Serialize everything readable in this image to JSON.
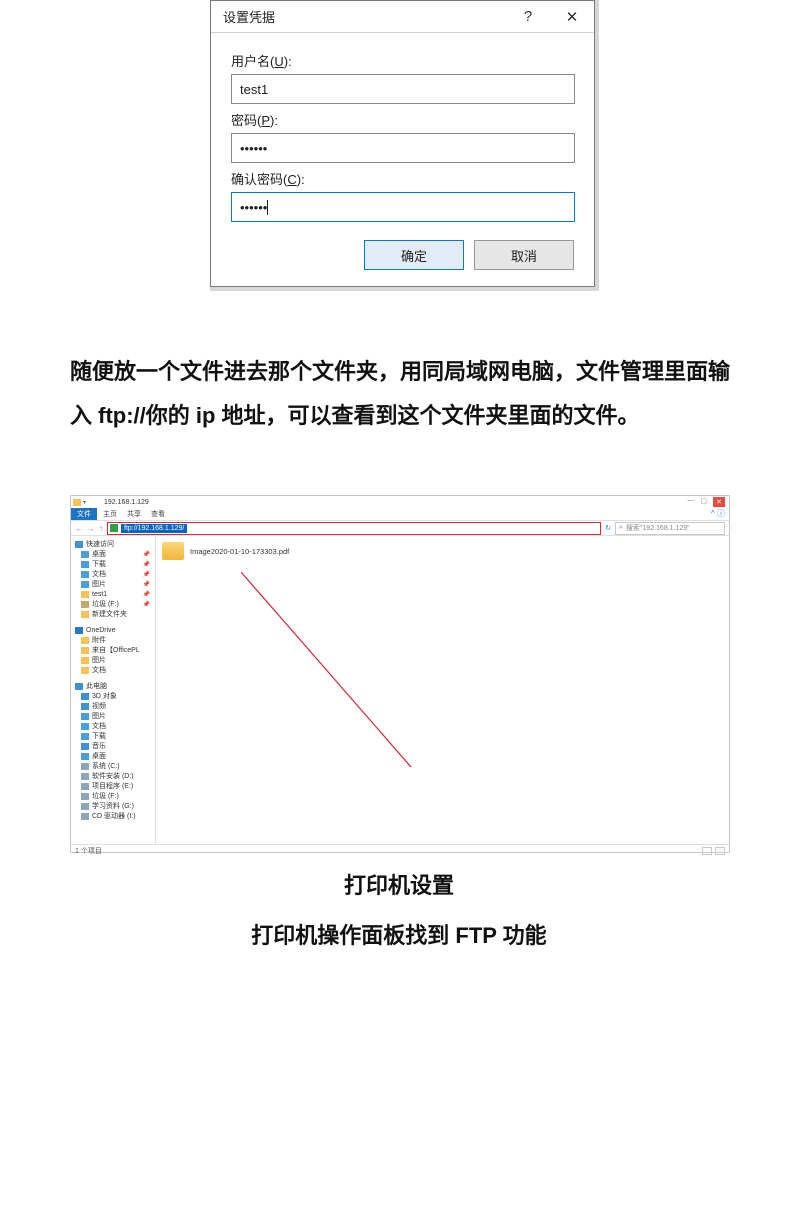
{
  "dialog": {
    "title": "设置凭据",
    "username_label_pre": "用户名(",
    "username_label_ul": "U",
    "username_label_post": "):",
    "username_value": "test1",
    "password_label_pre": "密码(",
    "password_label_ul": "P",
    "password_label_post": "):",
    "password_value": "••••••",
    "confirm_label_pre": "确认密码(",
    "confirm_label_ul": "C",
    "confirm_label_post": "):",
    "confirm_value": "••••••",
    "ok_label": "确定",
    "cancel_label": "取消"
  },
  "instruction": {
    "line1": "随便放一个文件进去那个文件夹，用同局域网电脑，文件管理里面输入 ftp://你的 ip 地址，可以查看到这个文件夹里面的文件。",
    "dummy": ""
  },
  "explorer": {
    "ip_title": "192.168.1.129",
    "tab_file": "文件",
    "tab_home": "主页",
    "tab_share": "共享",
    "tab_view": "查看",
    "address_text": "ftp://192.168.1.129/",
    "search_placeholder": "搜索\"192.168.1.129\"",
    "refresh": "↻",
    "sidebar": {
      "quick": "快速访问",
      "desktop": "桌面",
      "downloads": "下载",
      "documents": "文档",
      "pictures": "图片",
      "test1": "test1",
      "trash": "垃圾 (F:)",
      "newfolder": "新建文件夹",
      "onedrive": "OneDrive",
      "attachments": "附件",
      "fromoffice": "来自【OfficePL",
      "pictures2": "图片",
      "documents2": "文档",
      "thispc": "此电脑",
      "objects3d": "3D 对象",
      "videos": "视频",
      "pictures3": "图片",
      "documents3": "文档",
      "downloads2": "下载",
      "music": "音乐",
      "desktop2": "桌面",
      "drive_c": "系统 (C:)",
      "drive_d": "软件安装 (D:)",
      "drive_e": "项目程序 (E:)",
      "drive_f": "垃圾 (F:)",
      "drive_g": "学习资料 (G:)",
      "cd_drive": "CD 驱动器 (I:)"
    },
    "file_name": "Image2020-01-10-173303.pdf",
    "status": "1 个项目"
  },
  "printer": {
    "title": "打印机设置",
    "sub": "打印机操作面板找到 FTP 功能"
  }
}
